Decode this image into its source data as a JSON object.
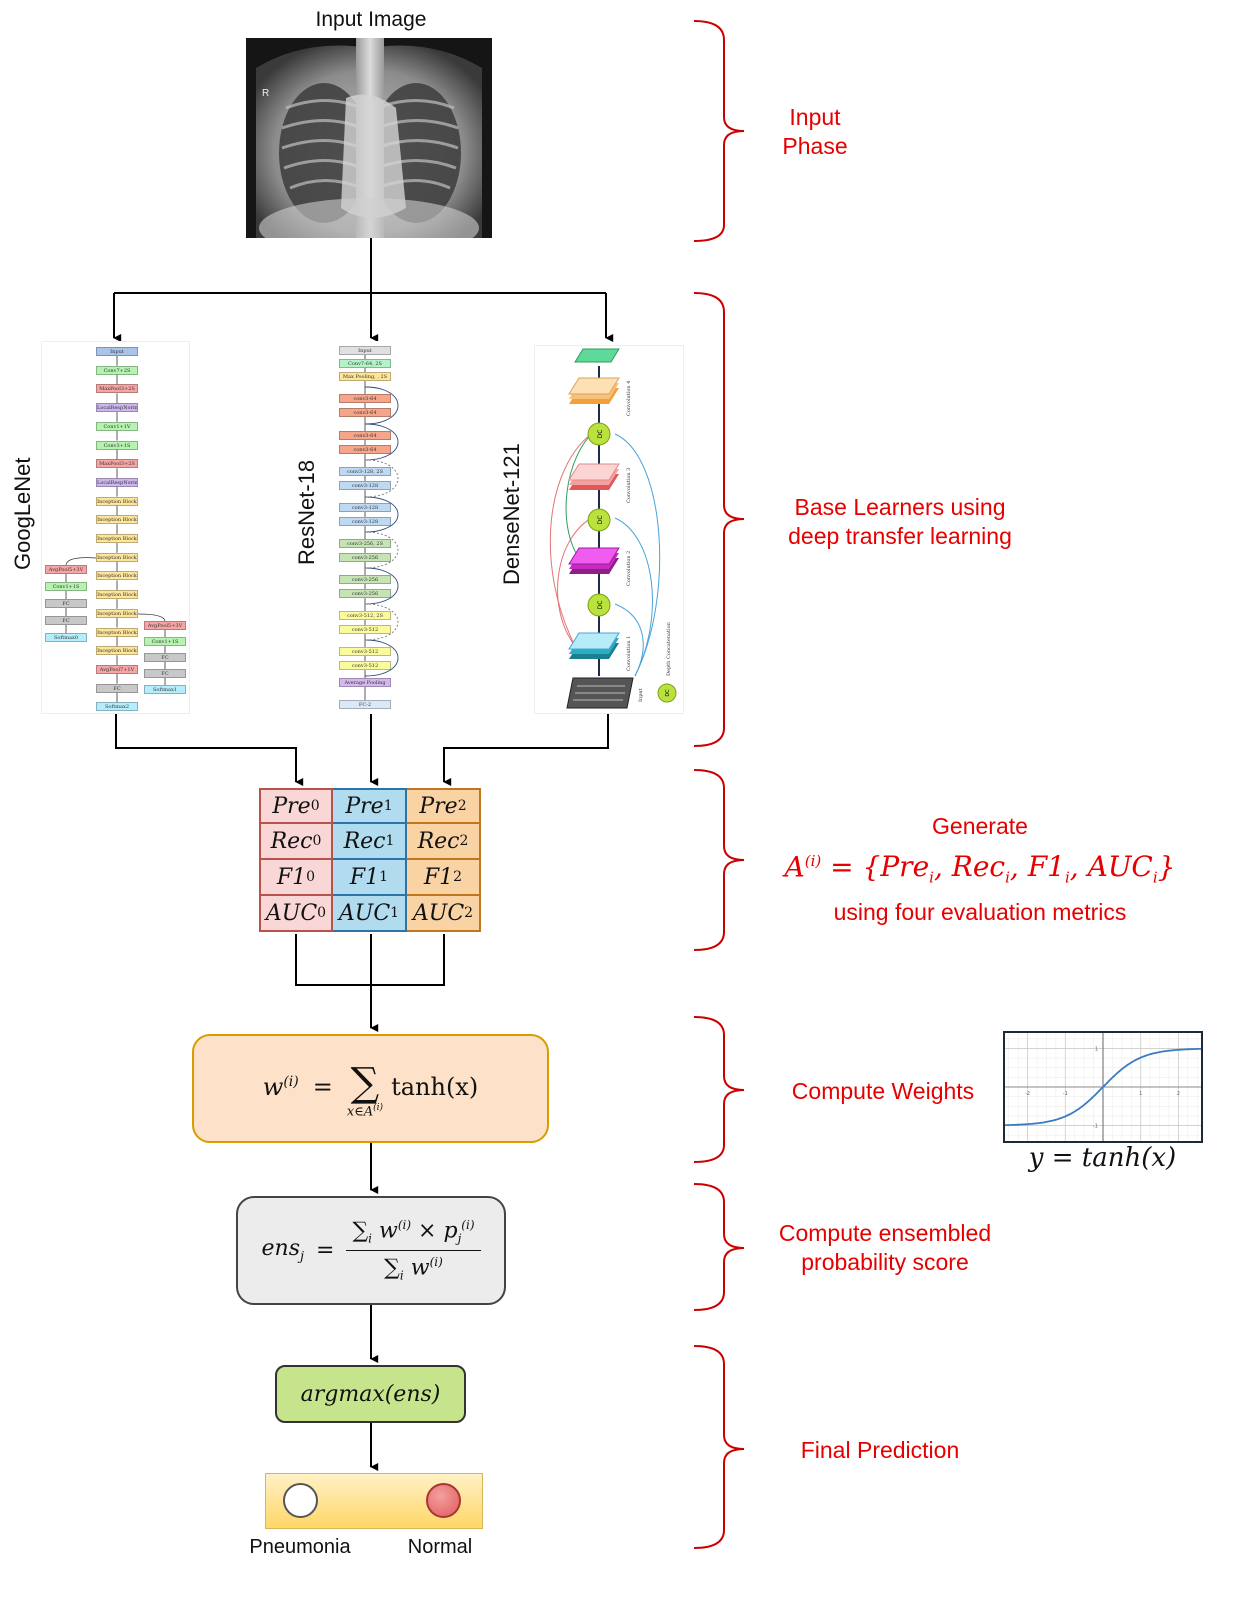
{
  "input": {
    "title": "Input Image",
    "xray_marker": "R"
  },
  "phases": {
    "input": "Input\nPhase",
    "input_line1": "Input",
    "input_line2": "Phase",
    "base_line1": "Base Learners using",
    "base_line2": "deep transfer learning",
    "generate_line1": "Generate",
    "generate_formula": "A^(i) = {Pre_i, Rec_i, F1_i, AUC_i}",
    "generate_line3": "using four evaluation metrics",
    "weights": "Compute Weights",
    "ensemble_line1": "Compute ensembled",
    "ensemble_line2": "probability score",
    "final": "Final Prediction"
  },
  "models": [
    {
      "name": "GoogLeNet",
      "main_blocks": [
        "Input",
        "Conv7+2S",
        "MaxPool3+2S",
        "LocalRespNorm",
        "Conv1+1V",
        "Conv3+1S",
        "MaxPool3+2S",
        "LocalRespNorm",
        "Inception Block",
        "Inception Block",
        "Inception Block",
        "Inception Block",
        "Inception Block",
        "Inception Block",
        "Inception Block",
        "Inception Block",
        "Inception Block",
        "AvgPool7+1V",
        "FC",
        "Softmax2"
      ],
      "aux1_blocks": [
        "AvgPool5+3V",
        "Conv1+1S",
        "FC",
        "FC",
        "Softmax0"
      ],
      "aux2_blocks": [
        "AvgPool5+3V",
        "Conv1+1S",
        "FC",
        "FC",
        "Softmax1"
      ]
    },
    {
      "name": "ResNet-18",
      "blocks": [
        "Input",
        "Conv7-64, 2S",
        "Max Pooling, , 2S",
        "conv3-64",
        "conv3-64",
        "conv3-64",
        "conv3-64",
        "conv3-128, 2S",
        "conv3-128",
        "conv3-128",
        "conv3-128",
        "conv3-256, 2S",
        "conv3-256",
        "conv3-256",
        "conv3-256",
        "conv3-512, 2S",
        "conv3-512",
        "conv3-512",
        "conv3-512",
        "Average Pooling",
        "FC-2"
      ]
    },
    {
      "name": "DenseNet-121",
      "layers": [
        "Input",
        "Convolution 1",
        "DC",
        "Convolution 2",
        "DC",
        "Convolution 3",
        "DC",
        "Convolution 4"
      ],
      "legend_symbol": "DC",
      "legend_label": "Depth Concatenation"
    }
  ],
  "metrics": {
    "rows": [
      [
        "Pre",
        "Pre",
        "Pre"
      ],
      [
        "Rec",
        "Rec",
        "Rec"
      ],
      [
        "F1",
        "F1",
        "F1"
      ],
      [
        "AUC",
        "AUC",
        "AUC"
      ]
    ],
    "subscripts": [
      "0",
      "1",
      "2"
    ],
    "colors": [
      "#f8d7d6",
      "#b1dcf0",
      "#fad3a5"
    ]
  },
  "formulas": {
    "weight_lhs": "w",
    "weight_sup": "(i)",
    "weight_eq": "=",
    "weight_sum": "∑",
    "weight_under": "x∈A",
    "weight_under_sup": "(i)",
    "weight_fn": "tanh(x)",
    "ens_lhs": "ens",
    "ens_lhs_sub": "j",
    "ens_eq": "=",
    "ens_num": "∑i w(i) × pj(i)",
    "ens_den": "∑i w(i)",
    "argmax": "argmax(ens)"
  },
  "tanh_plot": {
    "caption": "y = tanh(x)",
    "x_ticks": [
      "-2",
      "-1",
      "1",
      "2"
    ],
    "y_ticks": [
      "1",
      "-1"
    ],
    "line_color": "#3b7bbf"
  },
  "output": {
    "classes": [
      {
        "label": "Pneumonia",
        "fill": "#ffffff"
      },
      {
        "label": "Normal",
        "fill": "#e05a5a"
      }
    ]
  },
  "colors": {
    "phase_text": "#e60000",
    "bracket": "#cc0000",
    "arrow": "#000000"
  }
}
